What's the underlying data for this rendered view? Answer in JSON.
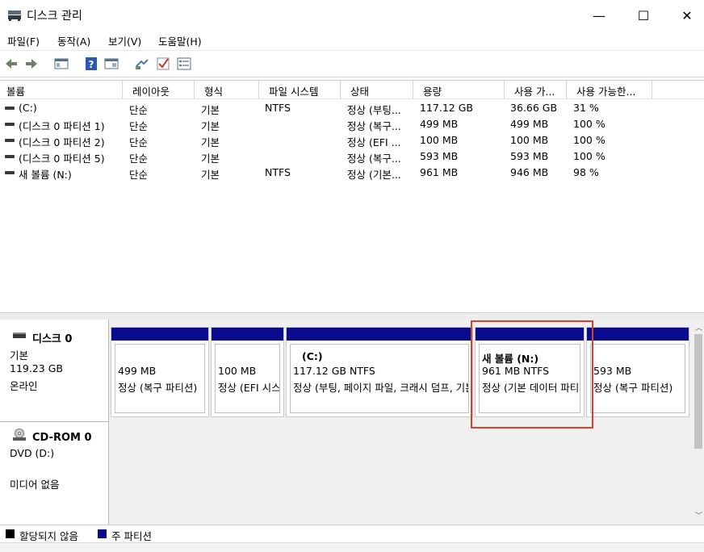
{
  "window": {
    "title": "디스크 관리",
    "minimize": "—",
    "maximize": "☐",
    "close": "✕"
  },
  "menu": [
    "파일(F)",
    "동작(A)",
    "보기(V)",
    "도움말(H)"
  ],
  "toolbar_icons": [
    "back-arrow-icon",
    "forward-arrow-icon",
    "console-tree-icon",
    "help-icon",
    "properties-icon",
    "connect-icon",
    "check-icon",
    "settings-list-icon"
  ],
  "columns": [
    "볼륨",
    "레이아웃",
    "형식",
    "파일 시스템",
    "상태",
    "용량",
    "사용 가...",
    "사용 가능한..."
  ],
  "volumes": [
    {
      "name": "(C:)",
      "layout": "단순",
      "type": "기본",
      "fs": "NTFS",
      "status": "정상 (부팅...",
      "capacity": "117.12 GB",
      "free": "36.66 GB",
      "pct": "31 %"
    },
    {
      "name": "(디스크 0 파티션 1)",
      "layout": "단순",
      "type": "기본",
      "fs": "",
      "status": "정상 (복구...",
      "capacity": "499 MB",
      "free": "499 MB",
      "pct": "100 %"
    },
    {
      "name": "(디스크 0 파티션 2)",
      "layout": "단순",
      "type": "기본",
      "fs": "",
      "status": "정상 (EFI ...",
      "capacity": "100 MB",
      "free": "100 MB",
      "pct": "100 %"
    },
    {
      "name": "(디스크 0 파티션 5)",
      "layout": "단순",
      "type": "기본",
      "fs": "",
      "status": "정상 (복구...",
      "capacity": "593 MB",
      "free": "593 MB",
      "pct": "100 %"
    },
    {
      "name": "새 볼륨 (N:)",
      "layout": "단순",
      "type": "기본",
      "fs": "NTFS",
      "status": "정상 (기본...",
      "capacity": "961 MB",
      "free": "946 MB",
      "pct": "98 %"
    }
  ],
  "disk0": {
    "name": "디스크 0",
    "type": "기본",
    "size": "119.23 GB",
    "state": "온라인",
    "partitions": [
      {
        "title": "",
        "line1": "499 MB",
        "line2": "정상 (복구 파티션)"
      },
      {
        "title": "",
        "line1": "100 MB",
        "line2": "정상 (EFI 시스템 파티션)"
      },
      {
        "title": "(C:)",
        "line1": "117.12 GB NTFS",
        "line2": "정상 (부팅, 페이지 파일, 크래시 덤프, 기본 데이터 파티션)"
      },
      {
        "title": "새 볼륨  (N:)",
        "line1": "961 MB NTFS",
        "line2": "정상 (기본 데이터 파티션)"
      },
      {
        "title": "",
        "line1": "593 MB",
        "line2": "정상 (복구 파티션)"
      }
    ]
  },
  "cdrom0": {
    "name": "CD-ROM 0",
    "drive": "DVD (D:)",
    "state": "미디어 없음"
  },
  "legend": [
    {
      "label": "할당되지 않음",
      "color": "#000000"
    },
    {
      "label": "주 파티션",
      "color": "#0a0a8c"
    }
  ]
}
